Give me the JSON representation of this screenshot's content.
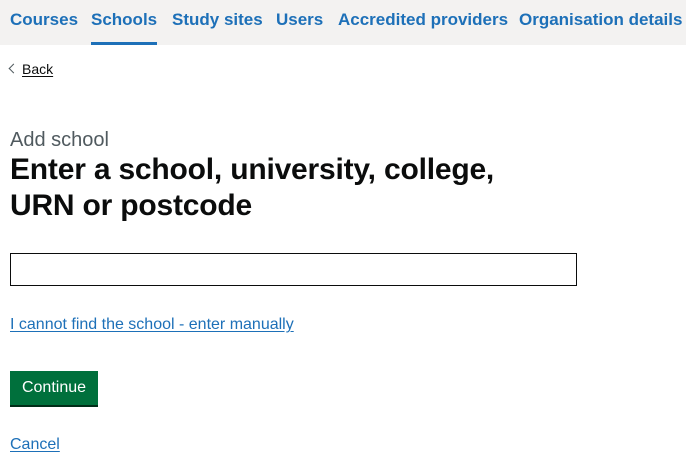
{
  "nav": {
    "items": [
      {
        "label": "Courses",
        "active": false
      },
      {
        "label": "Schools",
        "active": true
      },
      {
        "label": "Study sites",
        "active": false
      },
      {
        "label": "Users",
        "active": false
      },
      {
        "label": "Accredited providers",
        "active": false
      },
      {
        "label": "Organisation details",
        "active": false
      }
    ]
  },
  "back": {
    "label": "Back",
    "icon": "chevron-left-icon"
  },
  "form": {
    "caption": "Add school",
    "heading": "Enter a school, university, college, URN or postcode",
    "input_value": "",
    "manual_link": "I cannot find the school - enter manually",
    "continue_label": "Continue",
    "cancel_label": "Cancel"
  },
  "colors": {
    "link": "#1d70b8",
    "nav_background": "#f3f2f1",
    "button_green": "#00703c",
    "text": "#0b0c0c",
    "caption": "#505a5f"
  }
}
